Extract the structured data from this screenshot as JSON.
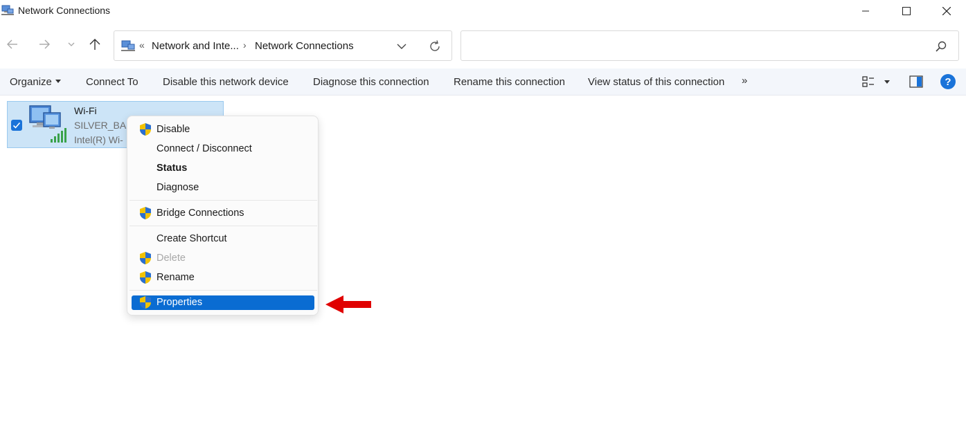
{
  "window": {
    "title": "Network Connections"
  },
  "address_bar": {
    "overflow_chevron": "«",
    "crumbs": [
      "Network and Inte...",
      "Network Connections"
    ],
    "separator": "›"
  },
  "search": {
    "placeholder": ""
  },
  "command_bar": {
    "organize": "Organize",
    "connect_to": "Connect To",
    "disable_device": "Disable this network device",
    "diagnose": "Diagnose this connection",
    "rename": "Rename this connection",
    "view_status": "View status of this connection",
    "more": "»",
    "help": "?"
  },
  "item": {
    "name": "Wi-Fi",
    "ssid": "SILVER_BAS",
    "adapter": "Intel(R) Wi-"
  },
  "context_menu": {
    "items": [
      {
        "label": "Disable",
        "shield": true
      },
      {
        "label": "Connect / Disconnect",
        "shield": false
      },
      {
        "label": "Status",
        "shield": false,
        "bold": true
      },
      {
        "label": "Diagnose",
        "shield": false
      },
      {
        "label": "Bridge Connections",
        "shield": true
      },
      {
        "label": "Create Shortcut",
        "shield": false
      },
      {
        "label": "Delete",
        "shield": true,
        "disabled": true
      },
      {
        "label": "Rename",
        "shield": true
      },
      {
        "label": "Properties",
        "shield": true,
        "selected": true
      }
    ]
  },
  "colors": {
    "accent": "#0a6cd2",
    "selection_bg": "#cce4f7",
    "command_bar_bg": "#f3f6fb",
    "annotation_arrow": "#e00000"
  }
}
